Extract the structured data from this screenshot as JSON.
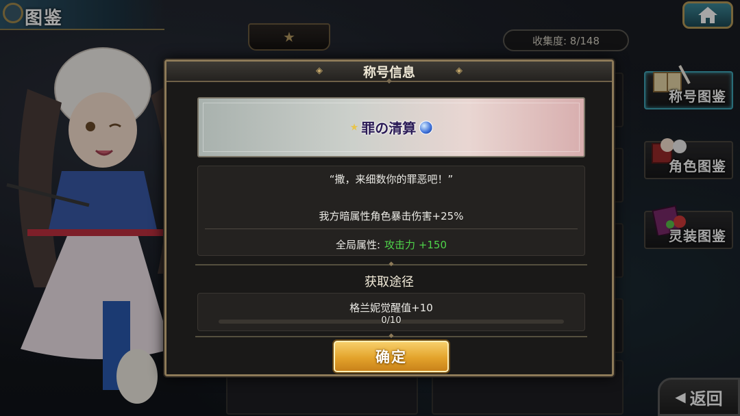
{
  "header": {
    "title": "图鉴",
    "home_icon": "home-icon"
  },
  "star_tab": {
    "label": "★"
  },
  "collection": {
    "text": "收集度: 8/148"
  },
  "sidebar": {
    "items": [
      {
        "label": "称号图鉴",
        "icon": "book-icon",
        "active": true
      },
      {
        "label": "角色图鉴",
        "icon": "characters-icon",
        "active": false
      },
      {
        "label": "灵装图鉴",
        "icon": "equipment-book-icon",
        "active": false
      }
    ]
  },
  "back_button": {
    "label": "返回",
    "icon": "back-arrow-icon"
  },
  "modal": {
    "title": "称号信息",
    "banner": {
      "title_name": "罪の清算"
    },
    "quote": "“撒，来细数你的罪恶吧！”",
    "effect": "我方暗属性角色暴击伤害+25%",
    "global_label": "全局属性:",
    "global_bonus": "攻击力 +150",
    "acquire_title": "获取途径",
    "acquire_condition": "格兰妮觉醒值+10",
    "progress_text": "0/10",
    "progress_fraction": 0.0,
    "confirm_label": "确定"
  },
  "colors": {
    "accent_gold": "#b79b5a",
    "bonus_green": "#4fd54a",
    "active_cyan": "#3fa7b8"
  }
}
